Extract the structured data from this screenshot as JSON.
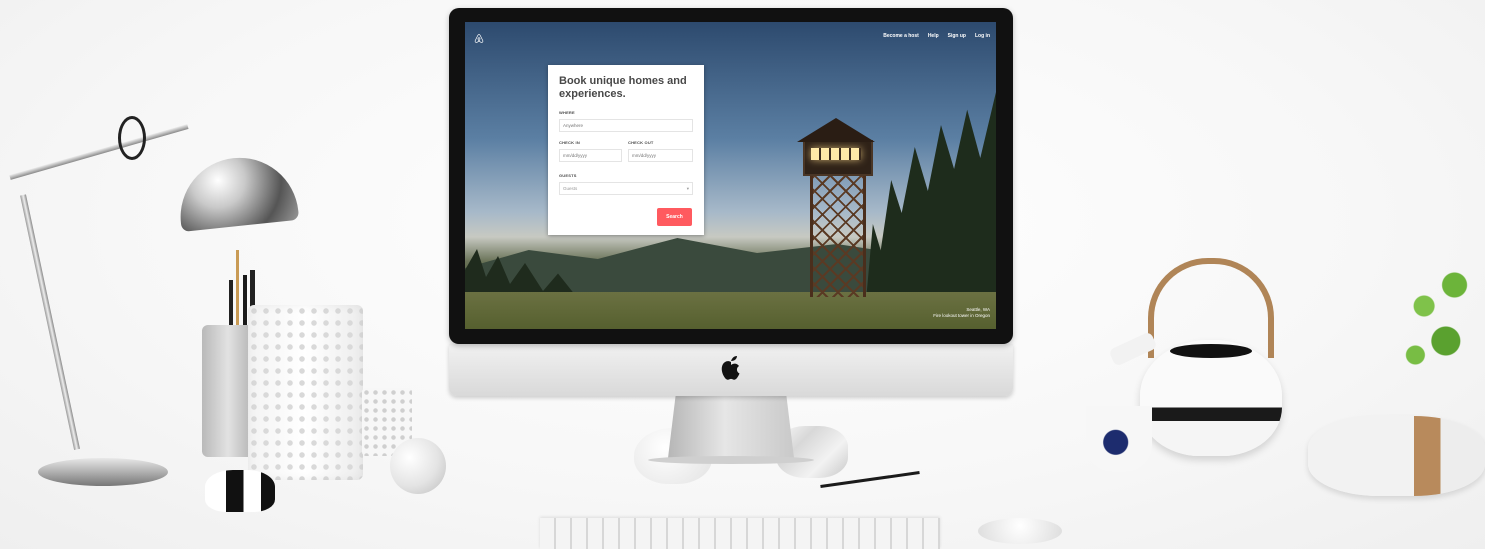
{
  "screen": {
    "nav": [
      {
        "label": "Become a host"
      },
      {
        "label": "Help"
      },
      {
        "label": "Sign up"
      },
      {
        "label": "Log in"
      }
    ],
    "booking": {
      "title": "Book unique homes and experiences.",
      "where_label": "WHERE",
      "where_placeholder": "Anywhere",
      "checkin_label": "CHECK IN",
      "checkin_placeholder": "mm/dd/yyyy",
      "checkout_label": "CHECK OUT",
      "checkout_placeholder": "mm/dd/yyyy",
      "guests_label": "GUESTS",
      "guests_value": "Guests",
      "search_label": "Search",
      "accent_color": "#FF5A5F"
    },
    "credit_line1": "Seattle, WA",
    "credit_line2": "Fire lookout tower in Oregon"
  },
  "icons": {
    "brand": "airbnb-logo-icon",
    "monitor": "apple-logo-icon"
  }
}
